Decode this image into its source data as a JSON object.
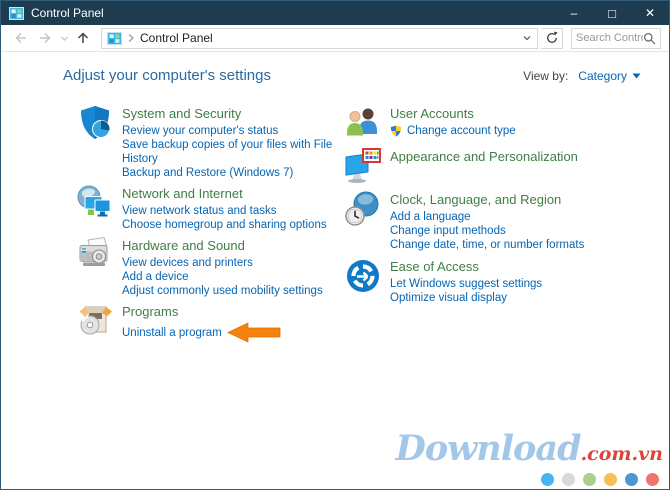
{
  "window": {
    "title": "Control Panel",
    "controls": {
      "minimize": "–",
      "maximize": "□",
      "close": "✕"
    }
  },
  "navbar": {
    "address_text": "Control Panel",
    "search_placeholder": "Search Control ...",
    "icons": [
      "back-icon",
      "forward-icon",
      "recent-locations-icon",
      "up-icon",
      "control-panel-icon",
      "breadcrumb-chevron-icon",
      "address-dropdown-icon",
      "refresh-icon",
      "search-icon"
    ]
  },
  "header": {
    "title": "Adjust your computer's settings",
    "view_by_label": "View by:",
    "view_by_value": "Category"
  },
  "categories": {
    "left": [
      {
        "id": "system-security",
        "title": "System and Security",
        "links": [
          "Review your computer's status",
          "Save backup copies of your files with File History",
          "Backup and Restore (Windows 7)"
        ]
      },
      {
        "id": "network-internet",
        "title": "Network and Internet",
        "links": [
          "View network status and tasks",
          "Choose homegroup and sharing options"
        ]
      },
      {
        "id": "hardware-sound",
        "title": "Hardware and Sound",
        "links": [
          "View devices and printers",
          "Add a device",
          "Adjust commonly used mobility settings"
        ]
      },
      {
        "id": "programs",
        "title": "Programs",
        "links": [
          "Uninstall a program"
        ],
        "arrow_annotation": true
      }
    ],
    "right": [
      {
        "id": "user-accounts",
        "title": "User Accounts",
        "links": [
          "Change account type"
        ],
        "uac_shield": true
      },
      {
        "id": "appearance-personalization",
        "title": "Appearance and Personalization",
        "links": []
      },
      {
        "id": "clock-language-region",
        "title": "Clock, Language, and Region",
        "links": [
          "Add a language",
          "Change input methods",
          "Change date, time, or number formats"
        ]
      },
      {
        "id": "ease-of-access",
        "title": "Ease of Access",
        "links": [
          "Let Windows suggest settings",
          "Optimize visual display"
        ]
      }
    ]
  },
  "watermark": {
    "brand": "Download",
    "suffix": ".com.vn",
    "dot_colors": [
      "#45b6f2",
      "#d9d9d9",
      "#a9d18e",
      "#f7c055",
      "#4a97d2",
      "#f07470"
    ]
  },
  "colors": {
    "titlebar-bg": "#1e3c50",
    "heading-blue": "#2b6a9e",
    "category-green": "#3f7e44",
    "link-blue": "#0665b3",
    "arrow-orange": "#f5820c",
    "watermark-blue": "#a3c7e8",
    "watermark-red": "#e04438"
  }
}
